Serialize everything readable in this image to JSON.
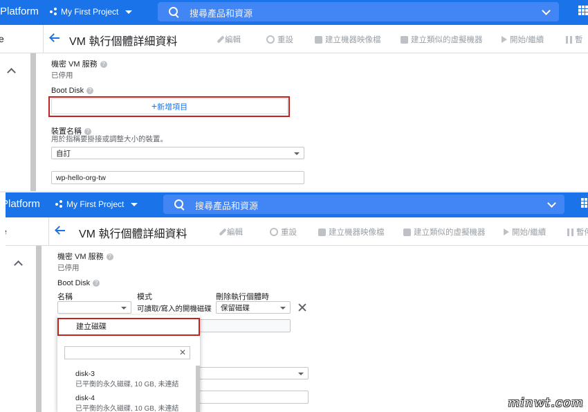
{
  "top_panel": {
    "topbar": {
      "brand": "Platform",
      "project": "My First Project",
      "search_placeholder": "搜尋產品和資源"
    },
    "toolbar": {
      "left_name": "e",
      "title": "VM 執行個體詳細資料",
      "actions": [
        "編輯",
        "重設",
        "建立機器映像檔",
        "建立類似的虛擬機器",
        "開始/繼續",
        "暫"
      ]
    },
    "confidential_label": "機密 VM 服務",
    "confidential_value": "已停用",
    "boot_disk_label": "Boot Disk",
    "add_item_label": "新增項目",
    "device_name_label": "裝置名稱",
    "device_name_desc": "用於指稱要掛接或調整大小的裝置。",
    "device_name_select": "自訂",
    "device_name_value": "wp-hello-org-tw"
  },
  "bottom_panel": {
    "topbar": {
      "brand": "Platform",
      "project": "My First Project",
      "search_placeholder": "搜尋產品和資源"
    },
    "toolbar": {
      "left_name": "e",
      "title": "VM 執行個體詳細資料",
      "actions": [
        "編輯",
        "重設",
        "建立機器映像檔",
        "建立類似的虛擬機器",
        "開始/繼續",
        "暫停"
      ]
    },
    "confidential_label": "機密 VM 服務",
    "confidential_value": "已停用",
    "boot_disk_label": "Boot Disk",
    "col_name": "名稱",
    "col_mode": "模式",
    "col_delete": "刪除執行個體時",
    "mode_value": "可讀取/寫入的開機磁碟",
    "delete_value": "保留磁碟",
    "menu": {
      "create_label": "建立磁碟",
      "items": [
        {
          "name": "disk-3",
          "desc": "已平衡的永久磁碟, 10 GB, 未連結"
        },
        {
          "name": "disk-4",
          "desc": "已平衡的永久磁碟, 10 GB, 未連結"
        }
      ]
    }
  },
  "watermark": "minwt.com",
  "colors": {
    "topbar": "#1a73e8",
    "highlight": "#c5221f",
    "link": "#1a73e8"
  }
}
